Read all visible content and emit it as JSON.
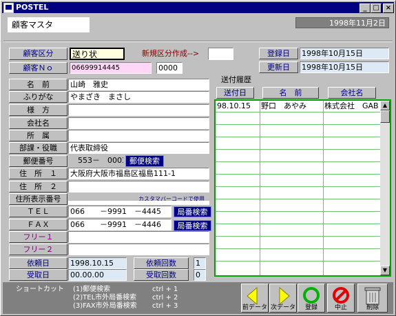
{
  "window": {
    "title": "POSTEL",
    "minimize_label": "_",
    "maximize_label": "□",
    "close_label": "×"
  },
  "header": {
    "form_title": "顧客マスタ",
    "current_date": "1998年11月2日"
  },
  "top": {
    "category_label": "顧客区分",
    "category_value": "送り状",
    "new_category_label": "新規区分作成-->",
    "new_category_value": "",
    "customer_no_label": "顧客Ｎｏ",
    "customer_no_value": "06699914445",
    "customer_no_suffix": "0000",
    "registered_label": "登録日",
    "registered_value": "1998年10月15日",
    "updated_label": "更新日",
    "updated_value": "1998年10月15日"
  },
  "fields": {
    "name_label": "名　前",
    "name_value": "山崎　雅史",
    "kana_label": "ふりがな",
    "kana_value": "やまざき　まさし",
    "honorific_label": "様　方",
    "honorific_value": "",
    "company_label": "会社名",
    "company_value": "",
    "affiliation_label": "所　属",
    "affiliation_value": "",
    "department_label": "部課・役職",
    "department_value": "代表取締役",
    "postal_label": "郵便番号",
    "postal_value": "553－　0003",
    "postal_search": "郵便検索",
    "address1_label": "住　所　１",
    "address1_value": "大阪府大阪市福島区福島111-1",
    "address2_label": "住　所　２",
    "address2_value": "",
    "addr_display_label": "住所表示番号",
    "barcode_note": "カスタマバーコードで使用",
    "tel_label": "ＴＥＬ",
    "tel_value": "066　　－9991　－4445",
    "tel_search": "局番検索",
    "fax_label": "ＦＡＸ",
    "fax_value": "066　　－9991　－4446",
    "fax_search": "局番検索",
    "free1_label": "フリー１",
    "free1_value": "",
    "free2_label": "フリー２",
    "free2_value": "",
    "request_date_label": "依頼日",
    "request_date_value": "1998.10.15",
    "request_count_label": "依頼回数",
    "request_count_value": "1",
    "receive_date_label": "受取日",
    "receive_date_value": "00.00.00",
    "receive_count_label": "受取回数",
    "receive_count_value": "0"
  },
  "history": {
    "title": "送付履歴",
    "columns": [
      "送付日",
      "名　前",
      "会社名"
    ],
    "rows": [
      {
        "date": "98.10.15",
        "name": "野口　あやみ",
        "company": "株式会社　GAB"
      }
    ]
  },
  "shortcuts": {
    "label": "ショートカット",
    "items": [
      {
        "name": "(1)郵便検索",
        "key": "ctrl + 1"
      },
      {
        "name": "(2)TEL市外局番検索",
        "key": "ctrl + 2"
      },
      {
        "name": "(3)FAX市外局番検索",
        "key": "ctrl + 3"
      }
    ]
  },
  "actions": {
    "prev": "前データ",
    "next": "次データ",
    "register": "登録",
    "cancel": "中止",
    "delete": "削除"
  },
  "colors": {
    "titlebar": "#000080",
    "window": "#c0c0c0",
    "list_border": "#00a000",
    "action_blue": "#000080",
    "arrow_yellow": "#ffff00",
    "ok_green": "#00b000",
    "stop_red": "#e00000"
  }
}
